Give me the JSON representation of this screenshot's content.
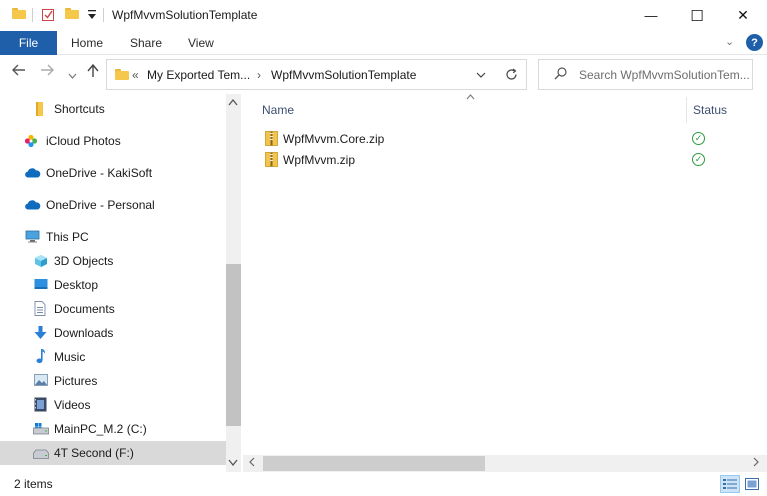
{
  "window": {
    "title": "WpfMvvmSolutionTemplate",
    "minimize": "—",
    "maximize": "☐",
    "close": "✕"
  },
  "ribbon": {
    "tabs": [
      "File",
      "Home",
      "Share",
      "View"
    ],
    "collapse_glyph": "⌄",
    "help_glyph": "?"
  },
  "address": {
    "overflow": "«",
    "crumbs": [
      "My Exported Tem...",
      "WpfMvvmSolutionTemplate"
    ],
    "separator": "›"
  },
  "search": {
    "placeholder": "Search WpfMvvmSolutionTem..."
  },
  "nav_pane": {
    "items": [
      {
        "label": "Shortcuts",
        "icon": "folder-icon"
      },
      {
        "label": "iCloud Photos",
        "icon": "icloud-photos-icon"
      },
      {
        "label": "OneDrive - KakiSoft",
        "icon": "onedrive-icon"
      },
      {
        "label": "OneDrive - Personal",
        "icon": "onedrive-icon"
      },
      {
        "label": "This PC",
        "icon": "this-pc-icon"
      },
      {
        "label": "3D Objects",
        "icon": "3d-objects-icon"
      },
      {
        "label": "Desktop",
        "icon": "desktop-icon"
      },
      {
        "label": "Documents",
        "icon": "documents-icon"
      },
      {
        "label": "Downloads",
        "icon": "downloads-icon"
      },
      {
        "label": "Music",
        "icon": "music-icon"
      },
      {
        "label": "Pictures",
        "icon": "pictures-icon"
      },
      {
        "label": "Videos",
        "icon": "videos-icon"
      },
      {
        "label": "MainPC_M.2 (C:)",
        "icon": "drive-c-icon"
      },
      {
        "label": "4T Second (F:)",
        "icon": "drive-icon",
        "selected": true
      }
    ]
  },
  "content": {
    "columns": {
      "name": "Name",
      "status": "Status"
    },
    "files": [
      {
        "name": "WpfMvvm.Core.zip",
        "status_icon": "synced-icon"
      },
      {
        "name": "WpfMvvm.zip",
        "status_icon": "synced-icon"
      }
    ]
  },
  "status_bar": {
    "item_count": "2 items"
  },
  "colors": {
    "file_tab": "#1f5fa9",
    "selection": "#d9d9d9",
    "synced": "#2e9a3e",
    "folder": "#f5c84c"
  }
}
